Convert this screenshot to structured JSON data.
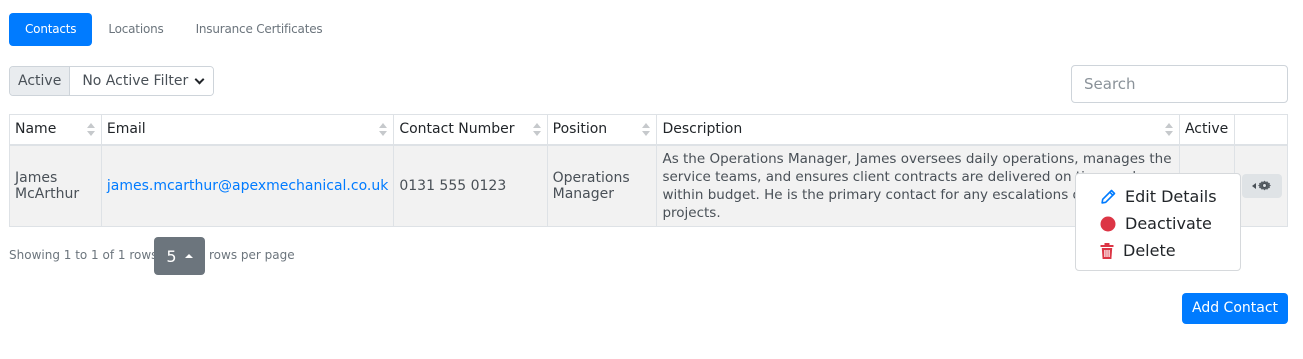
{
  "tabs": [
    {
      "label": "Contacts",
      "active": true
    },
    {
      "label": "Locations",
      "active": false
    },
    {
      "label": "Insurance Certificates",
      "active": false
    }
  ],
  "filter": {
    "label": "Active",
    "selected": "No Active Filter"
  },
  "search": {
    "placeholder": "Search"
  },
  "table": {
    "columns": [
      "Name",
      "Email",
      "Contact Number",
      "Position",
      "Description",
      "Active"
    ],
    "rows": [
      {
        "name": "James McArthur",
        "email": "james.mcarthur@apexmechanical.co.uk",
        "contact_number": "0131 555 0123",
        "position": "Operations Manager",
        "description": "As the Operations Manager, James oversees daily operations, manages the service teams, and ensures client contracts are delivered on time and within budget. He is the primary contact for any escalations or high-priority projects.",
        "active": ""
      }
    ]
  },
  "pagination": {
    "info": "Showing 1 to 1 of 1 rows",
    "page_size": "5",
    "rows_per_page_label": "rows per page"
  },
  "action_menu": {
    "items": [
      {
        "label": "Edit Details",
        "icon": "pencil-icon"
      },
      {
        "label": "Deactivate",
        "icon": "red-circle-icon"
      },
      {
        "label": "Delete",
        "icon": "trash-icon"
      }
    ]
  },
  "add_button": {
    "label": "Add Contact"
  },
  "colors": {
    "primary": "#007bff",
    "danger": "#dc3545",
    "secondary": "#6c757d"
  }
}
